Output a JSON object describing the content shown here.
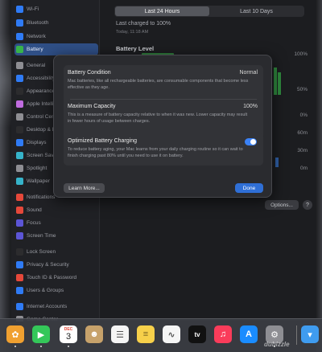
{
  "sidebar": {
    "items": [
      {
        "label": "Wi-Fi",
        "color": "#2f7bf5"
      },
      {
        "label": "Bluetooth",
        "color": "#2f7bf5"
      },
      {
        "label": "Network",
        "color": "#2f7bf5"
      },
      {
        "label": "Battery",
        "color": "#38b34a"
      },
      {
        "label": "General",
        "color": "#8e8e93"
      },
      {
        "label": "Accessibility",
        "color": "#2f7bf5"
      },
      {
        "label": "Appearance",
        "color": "#2c2c2e"
      },
      {
        "label": "Apple Intelligence",
        "color": "#c06ce0"
      },
      {
        "label": "Control Centre",
        "color": "#8e8e93"
      },
      {
        "label": "Desktop & Dock",
        "color": "#2c2c2e"
      },
      {
        "label": "Displays",
        "color": "#2f7bf5"
      },
      {
        "label": "Screen Saver",
        "color": "#36b3c9"
      },
      {
        "label": "Spotlight",
        "color": "#8e8e93"
      },
      {
        "label": "Wallpaper",
        "color": "#36b3c9"
      },
      {
        "label": "Notifications",
        "color": "#e5483a"
      },
      {
        "label": "Sound",
        "color": "#e5483a"
      },
      {
        "label": "Focus",
        "color": "#5c55d6"
      },
      {
        "label": "Screen Time",
        "color": "#5c55d6"
      },
      {
        "label": "Lock Screen",
        "color": "#2c2c2e"
      },
      {
        "label": "Privacy & Security",
        "color": "#2f7bf5"
      },
      {
        "label": "Touch ID & Password",
        "color": "#e5483a"
      },
      {
        "label": "Users & Groups",
        "color": "#2f7bf5"
      },
      {
        "label": "Internet Accounts",
        "color": "#2f7bf5"
      },
      {
        "label": "Game Center",
        "color": "#8e8e93"
      }
    ],
    "selected_index": 3
  },
  "main": {
    "tabs": [
      "Last 24 Hours",
      "Last 10 Days"
    ],
    "active_tab": 0,
    "last_charged": "Last charged to 100%",
    "last_charged_time": "Today, 11:18 AM",
    "battery_level_label": "Battery Level",
    "axis": {
      "top": "100%",
      "mid": "50%",
      "bottom": "0%",
      "lower1": "60m",
      "lower2": "30m",
      "lower3": "0m"
    },
    "options_label": "Options...",
    "help_label": "?"
  },
  "modal": {
    "battery_condition": {
      "title": "Battery Condition",
      "value": "Normal",
      "description": "Mac batteries, like all rechargeable batteries, are consumable components that become less effective as they age."
    },
    "maximum_capacity": {
      "title": "Maximum Capacity",
      "value": "100%",
      "description": "This is a measure of battery capacity relative to when it was new. Lower capacity may result in fewer hours of usage between charges."
    },
    "optimized_charging": {
      "title": "Optimized Battery Charging",
      "enabled": true,
      "description": "To reduce battery aging, your Mac learns from your daily charging routine so it can wait to finish charging past 80% until you need to use it on battery."
    },
    "learn_more_label": "Learn More...",
    "done_label": "Done"
  },
  "dock": {
    "apps": [
      {
        "name": "Photos",
        "glyph": "✿",
        "color": "#f0a030"
      },
      {
        "name": "FaceTime",
        "glyph": "▶",
        "color": "#34c759"
      },
      {
        "name": "Calendar",
        "month": "DEC",
        "day": "3",
        "color": "#ffffff"
      },
      {
        "name": "Contacts",
        "glyph": "☻",
        "color": "#c7a26b"
      },
      {
        "name": "Reminders",
        "glyph": "☰",
        "color": "#f5f5f5"
      },
      {
        "name": "Notes",
        "glyph": "≡",
        "color": "#f7d04a"
      },
      {
        "name": "Freeform",
        "glyph": "∿",
        "color": "#f5f5f5"
      },
      {
        "name": "TV",
        "glyph": "tv",
        "color": "#111111"
      },
      {
        "name": "Music",
        "glyph": "♫",
        "color": "#fa3c5a"
      },
      {
        "name": "App Store",
        "glyph": "A",
        "color": "#1a8cff"
      },
      {
        "name": "System Settings",
        "glyph": "⚙",
        "color": "#8e8e93"
      },
      {
        "name": "Downloads",
        "glyph": "▾",
        "color": "#3f9cf0"
      }
    ]
  },
  "watermark": "dubizzle"
}
